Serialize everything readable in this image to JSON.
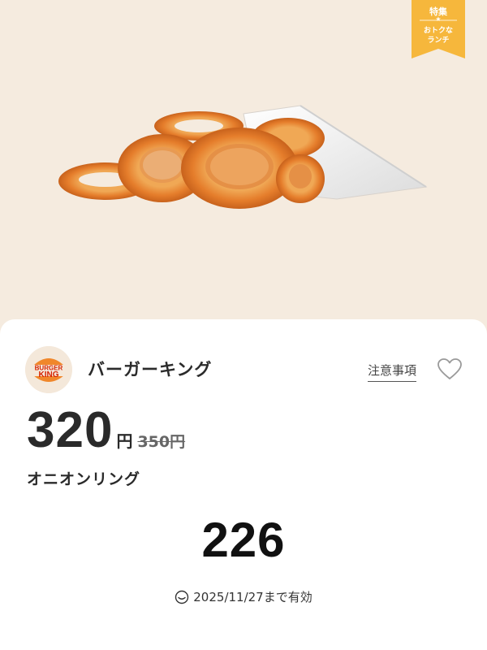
{
  "badge": {
    "title": "特集",
    "star": "★",
    "line1": "おトクな",
    "line2": "ランチ",
    "color": "#f6b73c"
  },
  "hero": {
    "image_icon": "onion-rings-image",
    "background_color": "#f5ebdf"
  },
  "store": {
    "logo_top": "BURGER",
    "logo_bottom": "KING",
    "name": "バーガーキング"
  },
  "actions": {
    "notes_label": "注意事項",
    "favorite_icon": "heart-icon"
  },
  "price": {
    "current": "320",
    "unit": "円",
    "original": "350円"
  },
  "item": {
    "name": "オニオンリング"
  },
  "coupon": {
    "code": "226"
  },
  "validity": {
    "icon": "clock-icon",
    "text": "2025/11/27まで有効"
  }
}
